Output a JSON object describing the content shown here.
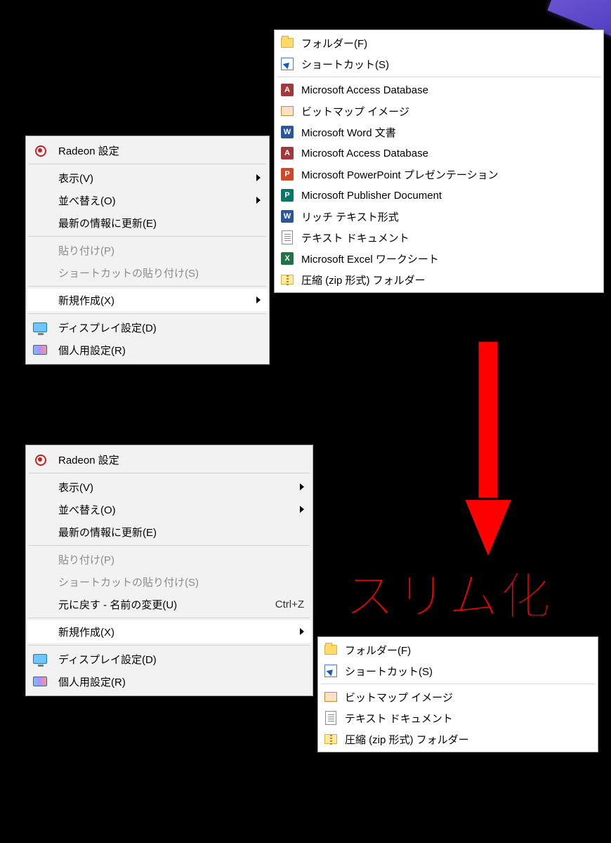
{
  "annotation": {
    "slim_label": "スリム化"
  },
  "context_menu": {
    "radeon": "Radeon 設定",
    "view": "表示(V)",
    "sort": "並べ替え(O)",
    "refresh": "最新の情報に更新(E)",
    "paste": "貼り付け(P)",
    "paste_sc": "ショートカットの貼り付け(S)",
    "undo": "元に戻す - 名前の変更(U)",
    "undo_key": "Ctrl+Z",
    "new": "新規作成(X)",
    "display": "ディスプレイ設定(D)",
    "personal": "個人用設定(R)"
  },
  "new_submenu_full": {
    "folder": "フォルダー(F)",
    "shortcut": "ショートカット(S)",
    "access1": "Microsoft Access Database",
    "bmp": "ビットマップ イメージ",
    "word": "Microsoft Word 文書",
    "access2": "Microsoft Access Database",
    "ppt": "Microsoft PowerPoint プレゼンテーション",
    "pub": "Microsoft Publisher Document",
    "rtf": "リッチ テキスト形式",
    "text": "テキスト ドキュメント",
    "excel": "Microsoft Excel ワークシート",
    "zip": "圧縮 (zip 形式) フォルダー"
  },
  "new_submenu_slim": {
    "folder": "フォルダー(F)",
    "shortcut": "ショートカット(S)",
    "bmp": "ビットマップ イメージ",
    "text": "テキスト ドキュメント",
    "zip": "圧縮 (zip 形式) フォルダー"
  }
}
